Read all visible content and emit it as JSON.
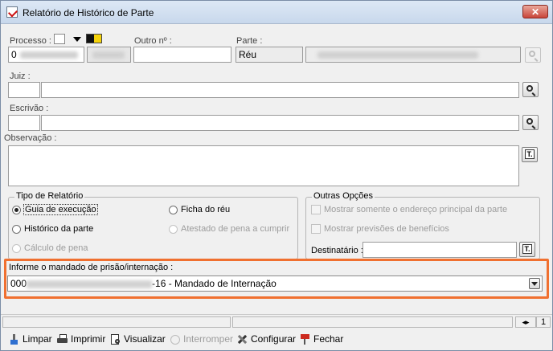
{
  "window": {
    "title": "Relatório de Histórico de Parte",
    "close": "✕"
  },
  "processo": {
    "label": "Processo :",
    "value": "0",
    "selector_text": "▾"
  },
  "outro": {
    "label": "Outro nº :"
  },
  "parte": {
    "label": "Parte :",
    "tipo_value": "Réu"
  },
  "juiz": {
    "label": "Juiz :"
  },
  "escrivao": {
    "label": "Escrivão :"
  },
  "observacao": {
    "label": "Observação :"
  },
  "tipo_relatorio": {
    "title": "Tipo de Relatório",
    "options": [
      {
        "label": "Guia de execução",
        "checked": true,
        "enabled": true
      },
      {
        "label": "Histórico da parte",
        "checked": false,
        "enabled": true
      },
      {
        "label": "Cálculo de pena",
        "checked": false,
        "enabled": false
      },
      {
        "label": "Ficha do réu",
        "checked": false,
        "enabled": true
      },
      {
        "label": "Atestado de pena a cumprir",
        "checked": false,
        "enabled": false
      }
    ]
  },
  "outras_opcoes": {
    "title": "Outras Opções",
    "options": [
      {
        "label": "Mostrar somente o endereço principal da parte",
        "checked": false,
        "enabled": false
      },
      {
        "label": "Mostrar previsões de benefícios",
        "checked": false,
        "enabled": false
      }
    ],
    "destinatario_label": "Destinatário :"
  },
  "mandado": {
    "label": "Informe o mandado de prisão/internação :",
    "prefix": "000",
    "suffix": "-16 - Mandado de Internação"
  },
  "statusbar": {
    "page": "1"
  },
  "toolbar": {
    "limpar": "Limpar",
    "imprimir": "Imprimir",
    "visualizar": "Visualizar",
    "interromper": "Interromper",
    "configurar": "Configurar",
    "fechar": "Fechar"
  },
  "colors": {
    "highlight": "#f07030",
    "close_button": "#c9453a"
  }
}
